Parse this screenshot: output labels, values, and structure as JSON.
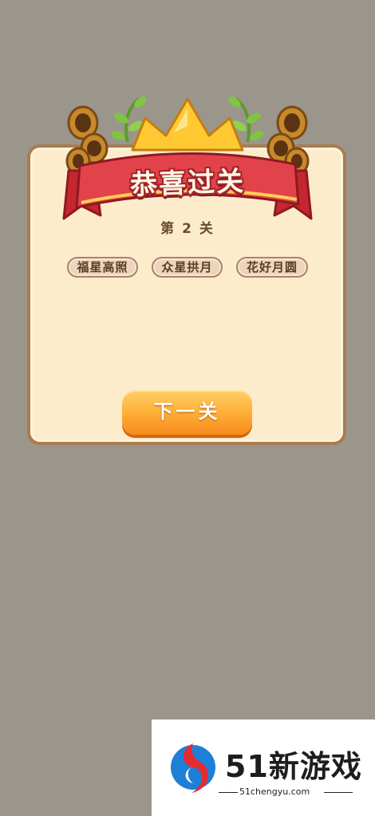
{
  "dialog": {
    "title": "恭喜过关",
    "level_label": "第 2 关",
    "idioms": [
      "福星高照",
      "众星拱月",
      "花好月圆"
    ],
    "next_button_label": "下一关"
  },
  "watermark": {
    "brand": "51新游戏",
    "url": "51chengyu.com"
  },
  "colors": {
    "background": "#9b968c",
    "panel": "#fdeccb",
    "banner_red": "#d83a3f",
    "crown_gold": "#ffc933",
    "button_orange": "#ffb33b"
  }
}
